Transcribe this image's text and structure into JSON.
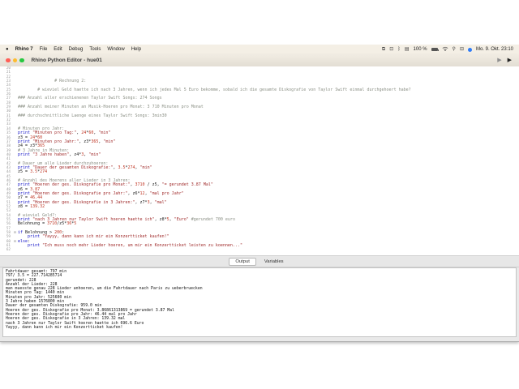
{
  "menu_bar": {
    "apple_logo": "apple-logo",
    "items": [
      {
        "label": "Rhino 7",
        "bold": true
      },
      {
        "label": "File",
        "bold": false
      },
      {
        "label": "Edit",
        "bold": false
      },
      {
        "label": "Debug",
        "bold": false
      },
      {
        "label": "Tools",
        "bold": false
      },
      {
        "label": "Window",
        "bold": false
      },
      {
        "label": "Help",
        "bold": false
      }
    ],
    "status": {
      "items": [
        {
          "name": "screen-mirroring-icon",
          "kind": "glyph",
          "glyph": "⧉"
        },
        {
          "name": "app-grid-icon",
          "kind": "glyph",
          "glyph": "⊡"
        },
        {
          "name": "bluetooth-icon",
          "kind": "glyph",
          "glyph": "ᛒ"
        },
        {
          "name": "display-icon",
          "kind": "glyph",
          "glyph": "▤"
        },
        {
          "name": "battery-percentage",
          "kind": "text",
          "text": "100 %"
        },
        {
          "name": "battery-icon",
          "kind": "battery"
        },
        {
          "name": "wifi-icon",
          "kind": "wifi"
        },
        {
          "name": "spotlight-icon",
          "kind": "glyph",
          "glyph": "⚲"
        },
        {
          "name": "control-center-icon",
          "kind": "glyph",
          "glyph": "⊟"
        },
        {
          "name": "siri-icon",
          "kind": "dot"
        }
      ],
      "clock": "Mo. 9. Okt. 23:10"
    }
  },
  "window": {
    "title": "Rhino Python Editor - hue01",
    "toolbar": [
      {
        "name": "run-no-debug-button",
        "glyph": "▶",
        "color": "#8f8f8f"
      },
      {
        "name": "run-debug-button",
        "glyph": "▶",
        "color": "#222222"
      }
    ]
  },
  "editor": {
    "lines": [
      {
        "n": 20,
        "seg": []
      },
      {
        "n": 21,
        "seg": []
      },
      {
        "n": 22,
        "seg": []
      },
      {
        "n": 23,
        "seg": [
          [
            "com",
            "               # Rechnung 2:"
          ]
        ]
      },
      {
        "n": 24,
        "seg": []
      },
      {
        "n": 25,
        "seg": [
          [
            "com",
            "        # wieviel Geld haette ich nach 3 Jahren, wenn ich jedes Mal 5 Euro bekomme, sobald ich die gesamte Diskografie von Taylor Swift einmal durchgehoert habe?"
          ]
        ]
      },
      {
        "n": 26,
        "seg": []
      },
      {
        "n": 27,
        "seg": [
          [
            "com",
            "### Anzahl aller erschienenen Taylor Swift Songs: 274 Songs"
          ]
        ]
      },
      {
        "n": 28,
        "seg": []
      },
      {
        "n": 29,
        "seg": [
          [
            "com",
            "### Anzahl meiner Minuten an Musik-Hoeren pro Monat: 3 710 Minuten pro Monat"
          ]
        ]
      },
      {
        "n": 30,
        "seg": []
      },
      {
        "n": 31,
        "seg": [
          [
            "com",
            "### durchschnittliche Laenge eines Taylor Swift Songs: 3min30"
          ]
        ]
      },
      {
        "n": 32,
        "seg": []
      },
      {
        "n": 33,
        "seg": []
      },
      {
        "n": 34,
        "seg": [
          [
            "com",
            "# Minuten pro Jahr:"
          ]
        ]
      },
      {
        "n": 35,
        "seg": [
          [
            "kw",
            "print "
          ],
          [
            "str",
            "\"Minuten pro Tag:\""
          ],
          [
            "pl",
            ", "
          ],
          [
            "num",
            "24"
          ],
          [
            "pl",
            "*"
          ],
          [
            "num",
            "60"
          ],
          [
            "pl",
            ", "
          ],
          [
            "str",
            "\"min\""
          ]
        ]
      },
      {
        "n": 36,
        "seg": [
          [
            "pl",
            "z3 = "
          ],
          [
            "num",
            "24"
          ],
          [
            "pl",
            "*"
          ],
          [
            "num",
            "60"
          ]
        ]
      },
      {
        "n": 37,
        "seg": [
          [
            "kw",
            "print "
          ],
          [
            "str",
            "\"Minuten pro Jahr:\""
          ],
          [
            "pl",
            ", z3*"
          ],
          [
            "num",
            "365"
          ],
          [
            "pl",
            ", "
          ],
          [
            "str",
            "\"min\""
          ]
        ]
      },
      {
        "n": 38,
        "seg": [
          [
            "pl",
            "z4 = z3*"
          ],
          [
            "num",
            "365"
          ]
        ]
      },
      {
        "n": 39,
        "seg": [
          [
            "com",
            "# 3 Jahre in Minuten:"
          ]
        ]
      },
      {
        "n": 40,
        "seg": [
          [
            "kw",
            "print "
          ],
          [
            "str",
            "\"3 Jahre haben\""
          ],
          [
            "pl",
            ", z4*"
          ],
          [
            "num",
            "3"
          ],
          [
            "pl",
            ", "
          ],
          [
            "str",
            "\"min\""
          ]
        ]
      },
      {
        "n": 41,
        "seg": []
      },
      {
        "n": 42,
        "seg": [
          [
            "com",
            "# Dauer um alle Lieder durchzuhoeren:"
          ]
        ]
      },
      {
        "n": 43,
        "seg": [
          [
            "kw",
            "print "
          ],
          [
            "str",
            "\"Dauer der gesamten Diskografie:\""
          ],
          [
            "pl",
            ", "
          ],
          [
            "num",
            "3.5"
          ],
          [
            "pl",
            "*"
          ],
          [
            "num",
            "274"
          ],
          [
            "pl",
            ", "
          ],
          [
            "str",
            "\"min\""
          ]
        ]
      },
      {
        "n": 44,
        "seg": [
          [
            "pl",
            "z5 = "
          ],
          [
            "num",
            "3.5"
          ],
          [
            "pl",
            "*"
          ],
          [
            "num",
            "274"
          ]
        ]
      },
      {
        "n": 45,
        "seg": []
      },
      {
        "n": 46,
        "seg": [
          [
            "com",
            "# Anzahl des Hoerens aller Lieder in 3 Jahren:"
          ]
        ]
      },
      {
        "n": 47,
        "seg": [
          [
            "kw",
            "print "
          ],
          [
            "str",
            "\"Hoeren der ges. Diskografie pro Monat:\""
          ],
          [
            "pl",
            ", "
          ],
          [
            "num",
            "3710"
          ],
          [
            "pl",
            " / z5, "
          ],
          [
            "str",
            "\"= gerundet 3.87 Mal\""
          ]
        ]
      },
      {
        "n": 48,
        "seg": [
          [
            "pl",
            "z6 = "
          ],
          [
            "num",
            "3.87"
          ]
        ]
      },
      {
        "n": 49,
        "seg": [
          [
            "kw",
            "print "
          ],
          [
            "str",
            "\"Hoeren der ges. Diskografie pro Jahr:\""
          ],
          [
            "pl",
            ", z6*"
          ],
          [
            "num",
            "12"
          ],
          [
            "pl",
            ", "
          ],
          [
            "str",
            "\"mal pro Jahr\""
          ]
        ]
      },
      {
        "n": 50,
        "seg": [
          [
            "pl",
            "z7 = "
          ],
          [
            "num",
            "46.44"
          ]
        ]
      },
      {
        "n": 51,
        "seg": [
          [
            "kw",
            "print "
          ],
          [
            "str",
            "\"Hoeren der ges. Diskografie in 3 Jahren:\""
          ],
          [
            "pl",
            ", z7*"
          ],
          [
            "num",
            "3"
          ],
          [
            "pl",
            ", "
          ],
          [
            "str",
            "\"mal\""
          ]
        ]
      },
      {
        "n": 52,
        "seg": [
          [
            "pl",
            "z8 = "
          ],
          [
            "num",
            "139.32"
          ]
        ]
      },
      {
        "n": 53,
        "seg": []
      },
      {
        "n": 54,
        "seg": [
          [
            "com",
            "# wieviel Geld?:"
          ]
        ]
      },
      {
        "n": 55,
        "seg": [
          [
            "kw",
            "print "
          ],
          [
            "str",
            "\"nach 3 Jahren nur Taylor Swift hoeren haette ich\""
          ],
          [
            "pl",
            ", z8*"
          ],
          [
            "num",
            "5"
          ],
          [
            "pl",
            ", "
          ],
          [
            "str",
            "\"Euro\""
          ],
          [
            "pl",
            " "
          ],
          [
            "com",
            "#gerundet 700 euro"
          ]
        ]
      },
      {
        "n": 56,
        "seg": [
          [
            "pl",
            "Belohnung = "
          ],
          [
            "num",
            "3710"
          ],
          [
            "pl",
            "/z5*"
          ],
          [
            "num",
            "36"
          ],
          [
            "pl",
            "*"
          ],
          [
            "num",
            "5"
          ]
        ]
      },
      {
        "n": 57,
        "seg": []
      },
      {
        "n": 58,
        "fold": true,
        "seg": [
          [
            "kw",
            "if "
          ],
          [
            "pl",
            "Belohnung > "
          ],
          [
            "num",
            "200"
          ],
          [
            "pl",
            ":"
          ]
        ]
      },
      {
        "n": 59,
        "seg": [
          [
            "pl",
            "    "
          ],
          [
            "kw",
            "print "
          ],
          [
            "str",
            "\"Yayyy, dann kann ich mir ein Konzertticket kaufen!\""
          ]
        ]
      },
      {
        "n": 60,
        "fold": true,
        "seg": [
          [
            "kw",
            "else"
          ],
          [
            "pl",
            ":"
          ]
        ]
      },
      {
        "n": 61,
        "seg": [
          [
            "pl",
            "    "
          ],
          [
            "kw",
            "print "
          ],
          [
            "str",
            "\"Ich muss noch mehr Lieder hoeren, um mir ein Konzertticket leisten zu koennen...\""
          ]
        ]
      },
      {
        "n": 62,
        "seg": []
      }
    ]
  },
  "panel": {
    "tabs": [
      {
        "label": "Output",
        "active": true
      },
      {
        "label": "Variables",
        "active": false
      }
    ],
    "output_lines": [
      "Fahrtdauer gesamt: 797 min",
      "797/ 3.5 = 227.714285714",
      "gerundet: 228",
      "Anzahl der Lieder: 228",
      "man muesste genau 228 Lieder anhoeren, um die Fahrtdauer nach Paris zu ueberbruecken",
      "Minuten pro Tag: 1440 min",
      "Minuten pro Jahr: 525600 min",
      "3 Jahre haben 1576800 min",
      "Dauer der gesamten Diskografie: 959.0 min",
      "Hoeren der ges. Diskografie pro Monat: 3.86861313869 = gerundet 3.87 Mal",
      "Hoeren der ges. Diskografie pro Jahr: 46.44 mal pro Jahr",
      "Hoeren der ges. Diskografie in 3 Jahren: 139.32 mal",
      "nach 3 Jahren nur Taylor Swift hoeren haette ich 696.6 Euro",
      "Yayyy, dann kann ich mir ein Konzertticket kaufen!"
    ]
  },
  "colors": {
    "menubar_bg": "#f4efe5",
    "traffic_red": "#ff5f57",
    "traffic_yellow": "#febc2e",
    "traffic_green": "#28c840",
    "syntax_keyword": "#1414c8",
    "syntax_string": "#a02b2b",
    "syntax_number": "#c03624",
    "syntax_comment": "#8a8f84",
    "panel_bg": "#e9e9e9"
  }
}
